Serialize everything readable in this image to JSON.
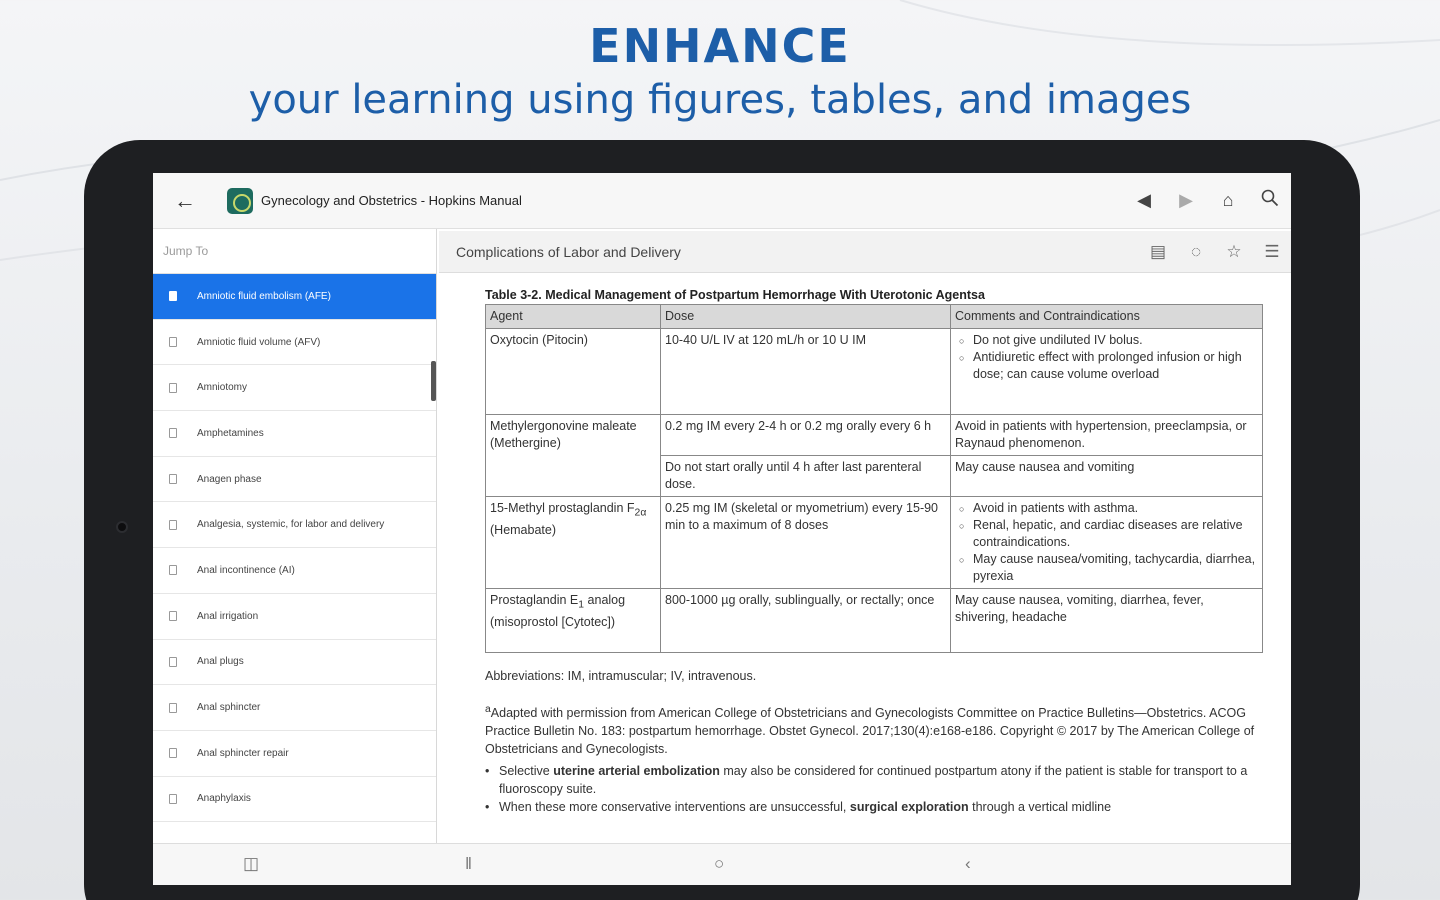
{
  "promo": {
    "headline": "ENHANCE",
    "subheadline": "your learning using figures, tables, and images"
  },
  "appbar": {
    "title": "Gynecology and Obstetrics - Hopkins Manual"
  },
  "sidebar": {
    "jump_label": "Jump To",
    "items": [
      {
        "label": "Amniotic fluid embolism (AFE)"
      },
      {
        "label": "Amniotic fluid volume (AFV)"
      },
      {
        "label": "Amniotomy"
      },
      {
        "label": "Amphetamines"
      },
      {
        "label": "Anagen phase"
      },
      {
        "label": "Analgesia, systemic, for labor and delivery"
      },
      {
        "label": "Anal incontinence (AI)"
      },
      {
        "label": "Anal irrigation"
      },
      {
        "label": "Anal plugs"
      },
      {
        "label": "Anal sphincter"
      },
      {
        "label": "Anal sphincter repair"
      },
      {
        "label": "Anaphylaxis"
      }
    ]
  },
  "content": {
    "section_title": "Complications of Labor and Delivery",
    "table_caption": "Table 3-2. Medical Management of Postpartum Hemorrhage With Uterotonic Agentsa",
    "headers": [
      "Agent",
      "Dose",
      "Comments and Contraindications"
    ],
    "rows": {
      "r1": {
        "agent": "Oxytocin (Pitocin)",
        "dose": "10-40 U/L IV at 120 mL/h or 10 U IM",
        "c1": "Do not give undiluted IV bolus.",
        "c2": "Antidiuretic effect with prolonged infusion or high dose; can cause volume overload"
      },
      "r2": {
        "agent": "Methylergonovine maleate (Methergine)",
        "dose1": "0.2 mg IM every 2-4 h or 0.2 mg orally every 6 h",
        "comment1": "Avoid in patients with hypertension, preeclampsia, or Raynaud phenomenon.",
        "dose2": "Do not start orally until 4 h after last parenteral dose.",
        "comment2": "May cause nausea and vomiting"
      },
      "r3": {
        "agent_a": "15-Methyl prostaglandin F",
        "agent_sub": "2α",
        "agent_b": "(Hemabate)",
        "dose": "0.25 mg IM (skeletal or myometrium) every 15-90 min to a maximum of 8 doses",
        "c1": "Avoid in patients with asthma.",
        "c2": "Renal, hepatic, and cardiac diseases are relative contraindications.",
        "c3": "May cause nausea/vomiting, tachycardia, diarrhea, pyrexia"
      },
      "r4": {
        "agent_a": "Prostaglandin E",
        "agent_sub": "1",
        "agent_b": "analog (misoprostol [Cytotec])",
        "dose": "800-1000 µg orally, sublingually, or rectally; once",
        "comment": "May cause nausea, vomiting, diarrhea, fever, shivering, headache"
      }
    },
    "abbreviations": "Abbreviations: IM, intramuscular; IV, intravenous.",
    "footnote_mark": "a",
    "footnote": "Adapted with permission from American College of Obstetricians and Gynecologists Committee on Practice Bulletins—Obstetrics. ACOG Practice Bulletin No. 183: postpartum hemorrhage. Obstet Gynecol. 2017;130(4):e168-e186. Copyright © 2017 by The American College of Obstetricians and Gynecologists.",
    "bullet1_a": "Selective ",
    "bullet1_b": "uterine arterial embolization",
    "bullet1_c": " may also be considered for continued postpartum atony if the patient is stable for transport to a fluoroscopy suite.",
    "bullet2_a": "When these more conservative interventions are unsuccessful, ",
    "bullet2_b": "surgical exploration",
    "bullet2_c": " through a vertical midline"
  },
  "icons": {
    "back": "arrow-left-icon",
    "prev": "triangle-left-icon",
    "next": "triangle-right-icon",
    "home": "home-icon",
    "search": "search-icon"
  }
}
